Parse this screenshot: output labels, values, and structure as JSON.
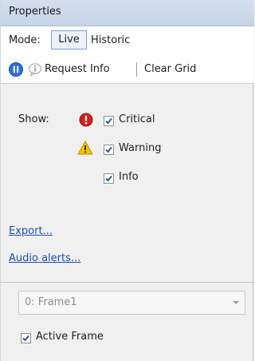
{
  "panel": {
    "title": "Properties"
  },
  "mode": {
    "label": "Mode:",
    "live": "Live",
    "historic": "Historic"
  },
  "toolbar": {
    "pause_icon": "pause-icon",
    "request_icon": "info-bubble-icon",
    "request_label": "Request Info",
    "clear_label": "Clear Grid"
  },
  "filters": {
    "show_label": "Show:",
    "items": [
      {
        "label": "Critical",
        "icon": "critical-error-icon",
        "checked": true
      },
      {
        "label": "Warning",
        "icon": "warning-icon",
        "checked": true
      },
      {
        "label": "Info",
        "icon": "",
        "checked": true
      }
    ]
  },
  "links": {
    "export": "Export...",
    "audio_alerts": "Audio alerts..."
  },
  "frame": {
    "dropdown_value": "0: Frame1",
    "active_frame_label": "Active Frame",
    "active_frame_checked": true
  },
  "colors": {
    "accent": "#1a4fb8",
    "critical": "#d42020",
    "warning": "#f0b400",
    "titlebar": "#c9d7e8"
  }
}
